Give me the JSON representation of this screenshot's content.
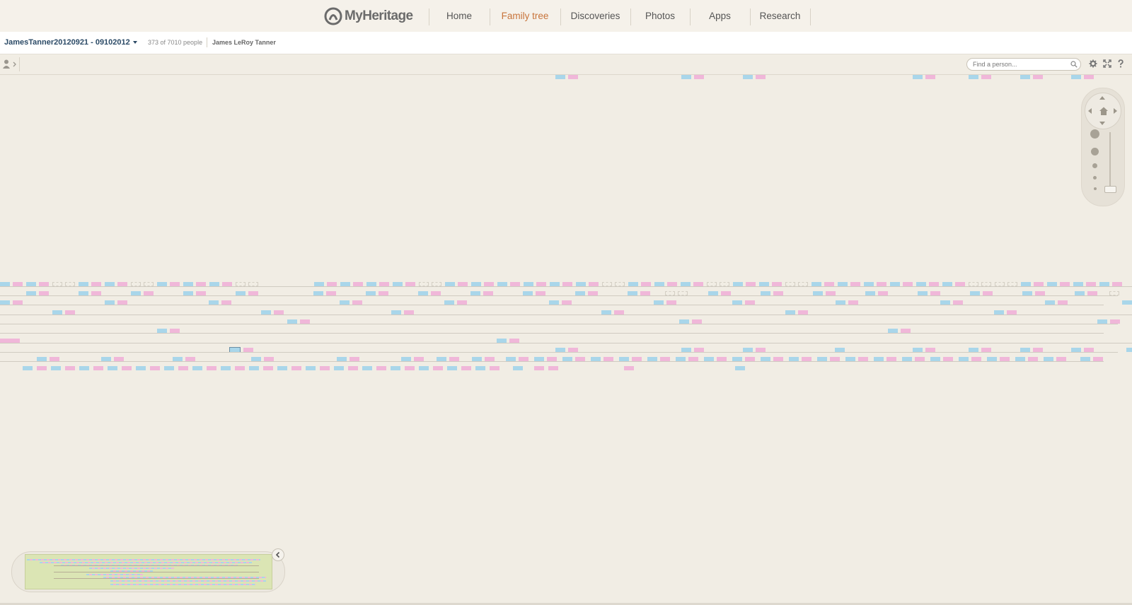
{
  "header": {
    "logo_text": "MyHeritage",
    "nav": [
      {
        "label": "Home",
        "active": false
      },
      {
        "label": "Family tree",
        "active": true
      },
      {
        "label": "Discoveries",
        "active": false
      },
      {
        "label": "Photos",
        "active": false
      },
      {
        "label": "Apps",
        "active": false
      },
      {
        "label": "Research",
        "active": false
      }
    ]
  },
  "tree_header": {
    "tree_name": "JamesTanner20120921 - 09102012",
    "people_count": "373 of 7010 people",
    "root_person": "James LeRoy Tanner"
  },
  "toolbar": {
    "find_placeholder": "Find a person...",
    "icons": [
      "person-icon",
      "settings-icon",
      "fullscreen-icon",
      "help-icon"
    ]
  },
  "zoom": {
    "level_fraction": 0.1
  },
  "colors": {
    "male_card": "#a9d6ea",
    "female_card": "#f0b7d9",
    "active_nav": "#c8743b",
    "background": "#f1ede4"
  }
}
